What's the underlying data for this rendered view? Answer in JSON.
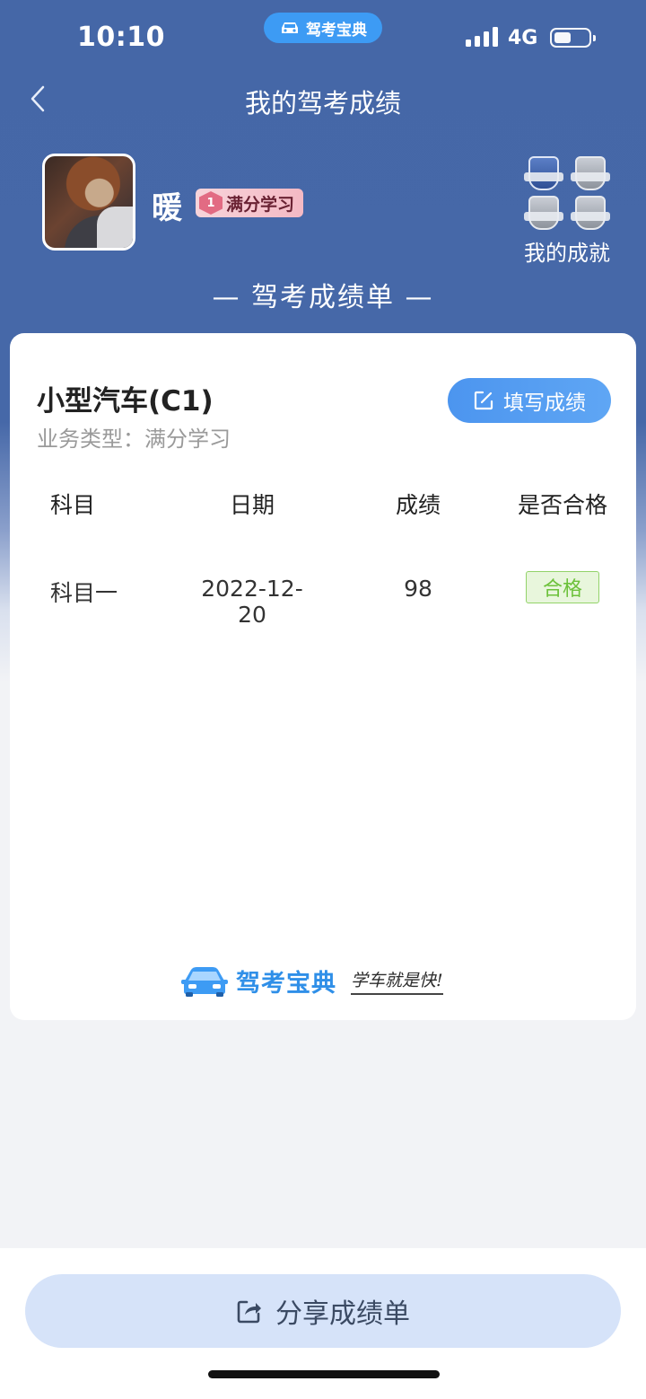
{
  "status_bar": {
    "time": "10:10",
    "app_pill": "驾考宝典",
    "network": "4G"
  },
  "header": {
    "title": "我的驾考成绩"
  },
  "profile": {
    "username": "暖",
    "plan_level": "1",
    "plan_label": "满分学习",
    "achievements_label": "我的成就"
  },
  "section_title": "— 驾考成绩单 —",
  "card": {
    "vehicle_type": "小型汽车(C1)",
    "business_type": "业务类型：满分学习",
    "fill_button": "填写成绩",
    "columns": [
      "科目",
      "日期",
      "成绩",
      "是否合格"
    ],
    "rows": [
      {
        "subject": "科目一",
        "date": "2022-12-20",
        "score": "98",
        "status": "合格"
      }
    ],
    "brand_name": "驾考宝典",
    "brand_slogan": "学车就是快!"
  },
  "share_button": "分享成绩单",
  "colors": {
    "header_bg": "#4567a7",
    "accent_blue": "#4c95ef",
    "pass_green": "#6cc13a",
    "share_bg": "#d6e3f9"
  }
}
